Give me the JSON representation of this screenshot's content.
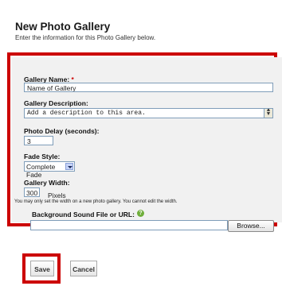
{
  "header": {
    "title": "New Photo Gallery",
    "subtitle": "Enter the information for this Photo Gallery below."
  },
  "form": {
    "gallery_name": {
      "label": "Gallery Name:",
      "required_mark": "*",
      "value": "Name of Gallery"
    },
    "gallery_description": {
      "label": "Gallery Description:",
      "value": "Add a description to this area."
    },
    "photo_delay": {
      "label": "Photo Delay (seconds):",
      "value": "3"
    },
    "fade_style": {
      "label": "Fade Style:",
      "selected": "Complete Fade"
    },
    "gallery_width": {
      "label": "Gallery Width:",
      "value": "300",
      "unit": "Pixels",
      "note": "You may only set the width on a new photo gallery. You cannot edit the width."
    },
    "background_sound": {
      "label": "Background Sound File or URL:",
      "value": "",
      "browse_label": "Browse..."
    }
  },
  "actions": {
    "save_label": "Save",
    "cancel_label": "Cancel"
  },
  "colors": {
    "highlight": "#cc0000",
    "panel": "#f1f1f1",
    "required": "#cc0000",
    "help_icon": "#6fae3a"
  },
  "icons": {
    "help": "help-icon",
    "scroll": "scroll-arrows-icon",
    "dropdown": "chevron-down-icon"
  }
}
